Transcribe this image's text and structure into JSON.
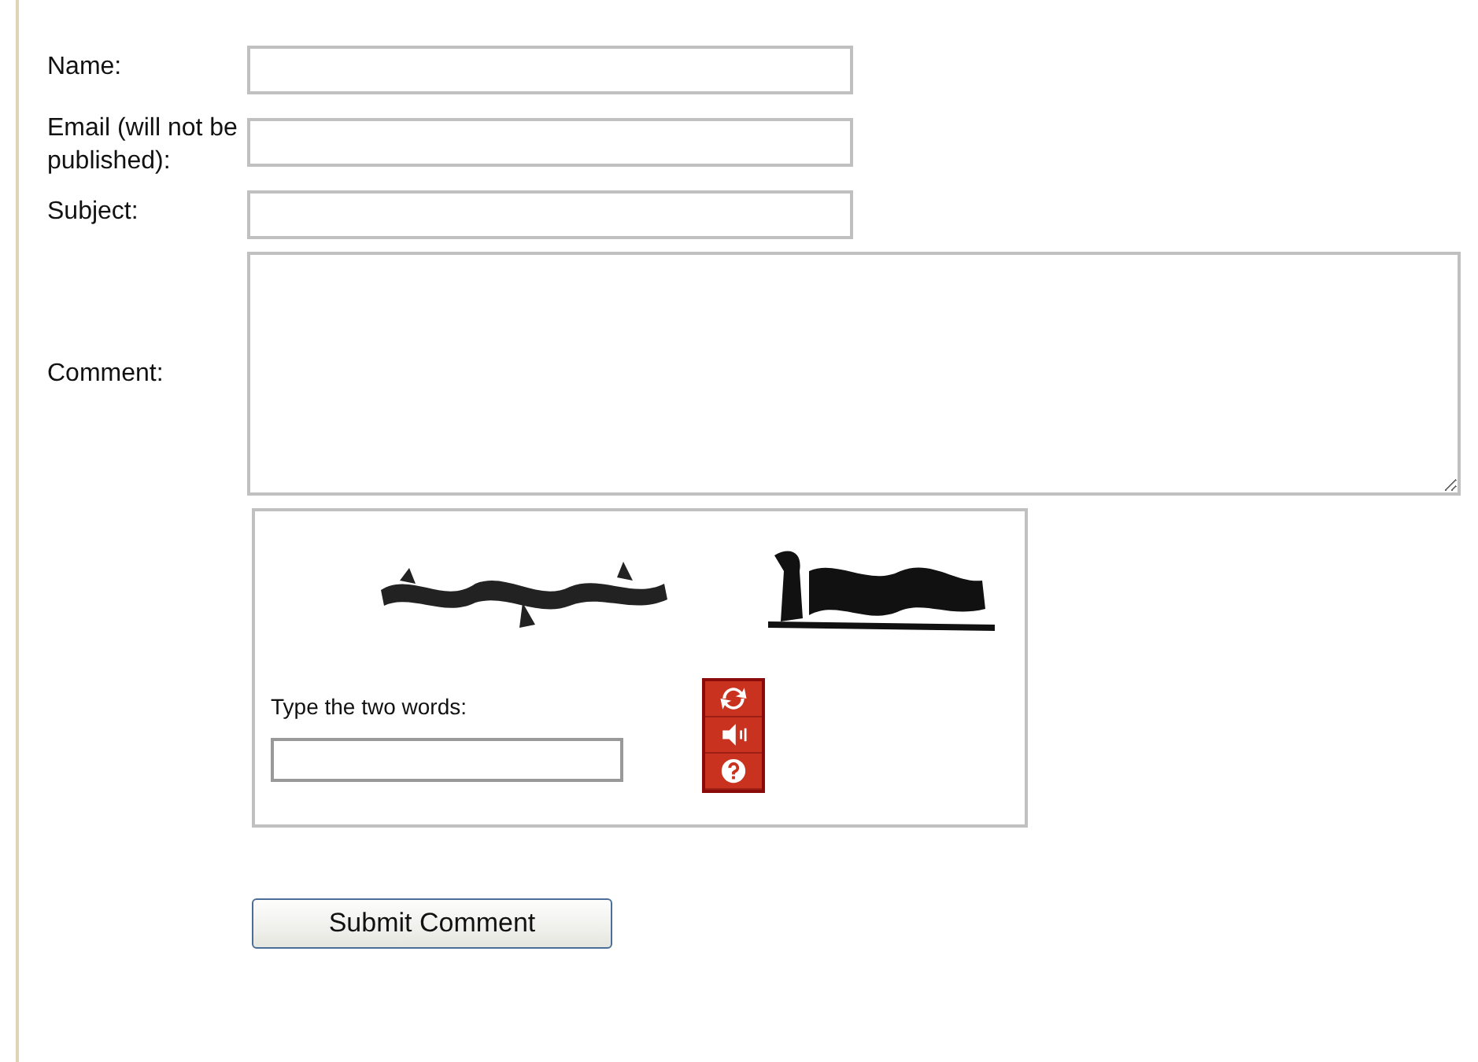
{
  "fields": [
    {
      "label": "Name:",
      "kind": "input"
    },
    {
      "label": "Email (will not be published):",
      "kind": "input"
    },
    {
      "label": "Subject:",
      "kind": "input"
    },
    {
      "label": "Comment:",
      "kind": "textarea"
    }
  ],
  "captcha": {
    "prompt": "Type the two words:",
    "kind": "picture"
  },
  "submit": "Submit Comment"
}
